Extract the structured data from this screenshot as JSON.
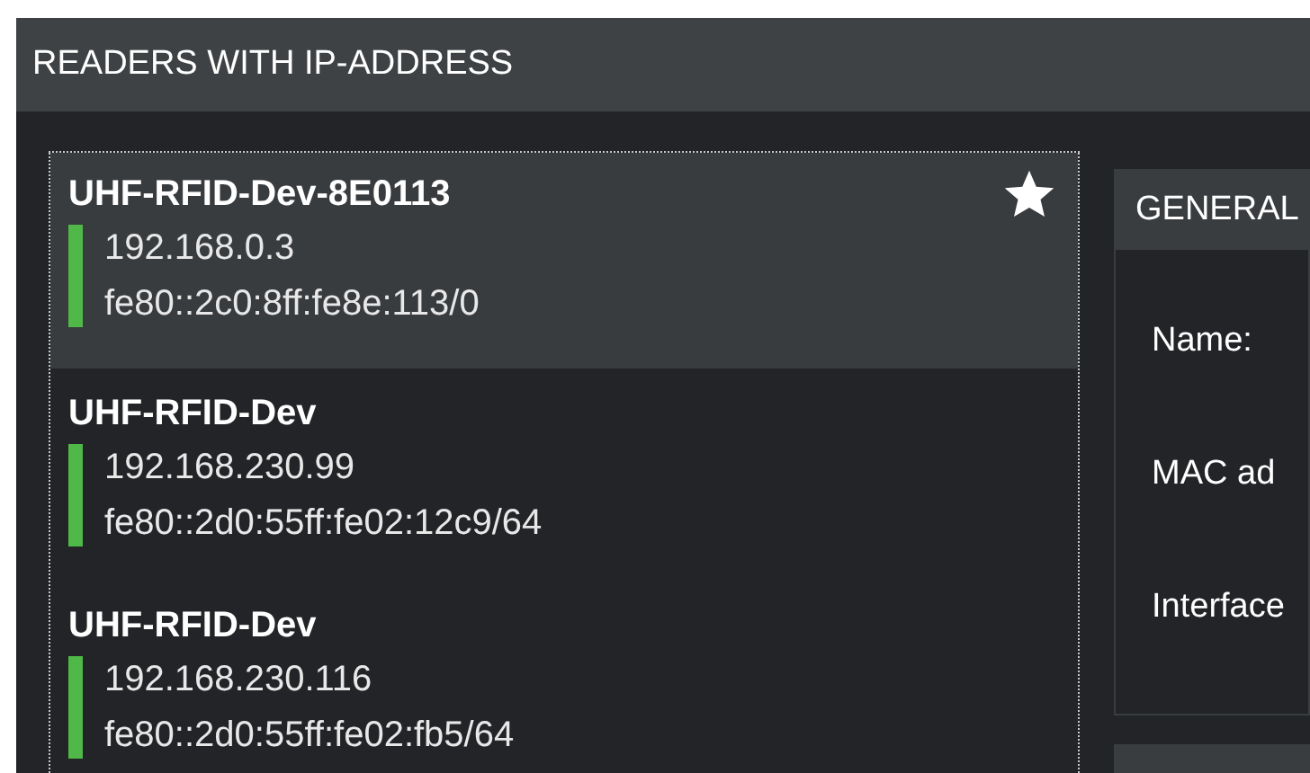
{
  "panel": {
    "title": "READERS WITH IP-ADDRESS"
  },
  "readers": [
    {
      "name": "UHF-RFID-Dev-8E0113",
      "selected": true,
      "favorite": true,
      "color": "#4fb848",
      "ipv4": "192.168.0.3",
      "ipv6": "fe80::2c0:8ff:fe8e:113/0"
    },
    {
      "name": "UHF-RFID-Dev",
      "selected": false,
      "favorite": false,
      "color": "#4fb848",
      "ipv4": "192.168.230.99",
      "ipv6": "fe80::2d0:55ff:fe02:12c9/64"
    },
    {
      "name": "UHF-RFID-Dev",
      "selected": false,
      "favorite": false,
      "color": "#4fb848",
      "ipv4": "192.168.230.116",
      "ipv6": "fe80::2d0:55ff:fe02:fb5/64"
    }
  ],
  "general": {
    "title": "GENERAL",
    "fields": [
      "Name:",
      "MAC ad",
      "Interface"
    ]
  }
}
